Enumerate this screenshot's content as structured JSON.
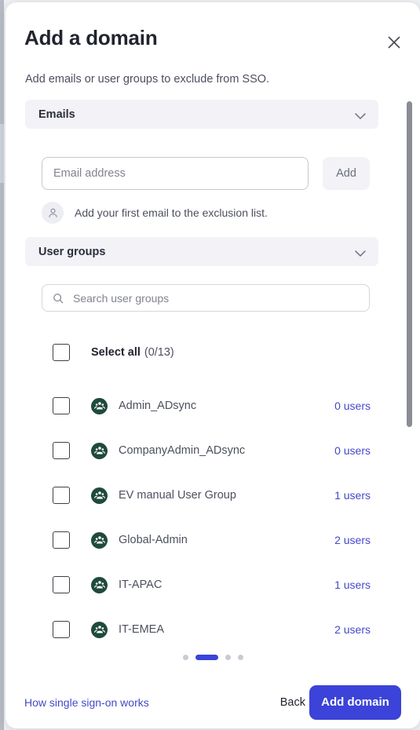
{
  "modal": {
    "title": "Add a domain",
    "subtitle": "Add emails or user groups to exclude from SSO.",
    "close_icon": "close-icon"
  },
  "emails_section": {
    "header_label": "Emails",
    "chevron_icon": "chevron-down-icon",
    "input_placeholder": "Email address",
    "input_value": "",
    "add_button_label": "Add",
    "empty_state_icon": "person-icon",
    "empty_state_text": "Add your first email to the exclusion list."
  },
  "user_groups_section": {
    "header_label": "User groups",
    "chevron_icon": "chevron-down-icon",
    "search_icon": "search-icon",
    "search_placeholder": "Search user groups",
    "search_value": "",
    "select_all_label": "Select all",
    "select_all_count": "(0/13)",
    "group_icon": "group-avatar-icon",
    "groups": [
      {
        "name": "Admin_ADsync",
        "users": "0 users"
      },
      {
        "name": "CompanyAdmin_ADsync",
        "users": "0 users"
      },
      {
        "name": "EV manual User Group",
        "users": "1 users"
      },
      {
        "name": "Global-Admin",
        "users": "2 users"
      },
      {
        "name": "IT-APAC",
        "users": "1 users"
      },
      {
        "name": "IT-EMEA",
        "users": "2 users"
      }
    ]
  },
  "pagination": {
    "total": 4,
    "active_index": 1
  },
  "footer": {
    "help_link": "How single sign-on works",
    "back_label": "Back",
    "primary_label": "Add domain"
  },
  "colors": {
    "accent_blue": "#3b43d8",
    "link_blue": "#4448c9",
    "group_green": "#1f4a3d",
    "accordion_bg": "#f2f2f7",
    "scrollbar": "#8a8d96"
  }
}
